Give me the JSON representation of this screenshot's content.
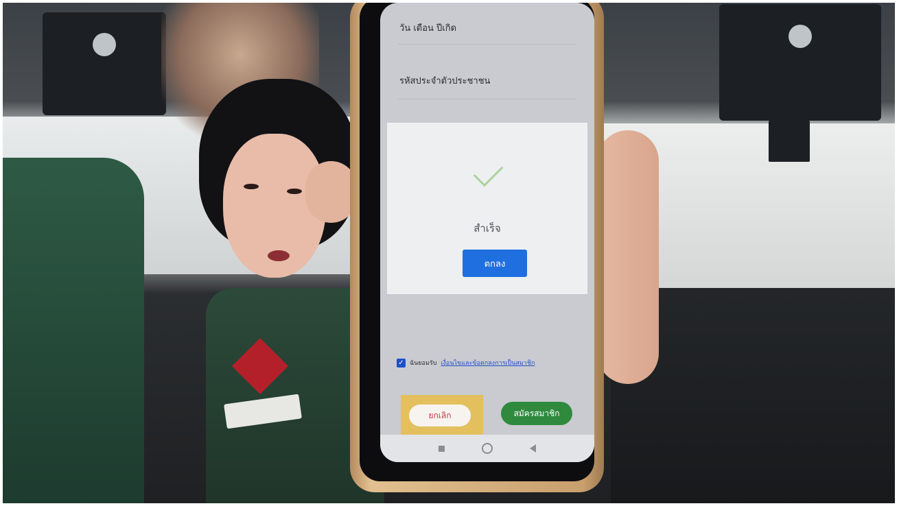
{
  "screen": {
    "form": {
      "dob_label": "วัน เดือน ปีเกิด",
      "id_label": "รหัสประจำตัวประชาชน"
    },
    "dialog": {
      "icon": "checkmark-icon",
      "message": "สำเร็จ",
      "ok_label": "ตกลง"
    },
    "consent": {
      "prefix": "ฉันยอมรับ",
      "link_text": "เงื่อนไขและข้อตกลงการเป็นสมาชิก",
      "checked": true
    },
    "buttons": {
      "cancel_label": "ยกเลิก",
      "register_label": "สมัครสมาชิก"
    },
    "navbar": [
      "recent-apps-icon",
      "home-icon",
      "back-icon"
    ]
  },
  "colors": {
    "ok_button": "#1f6fe0",
    "register_button": "#2f8a3e",
    "cancel_text": "#c0394a",
    "check": "#a9d39d"
  }
}
